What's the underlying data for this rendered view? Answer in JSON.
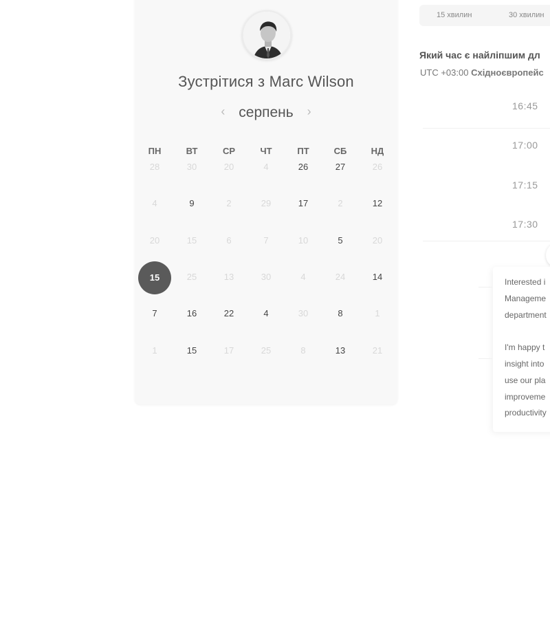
{
  "host": {
    "title": "Зустрітися з Marc Wilson"
  },
  "calendar": {
    "month": "серпень",
    "prev_icon": "chevron-left-icon",
    "next_icon": "chevron-right-icon",
    "weekdays": [
      "ПН",
      "ВТ",
      "СР",
      "ЧТ",
      "ПТ",
      "СБ",
      "НД"
    ],
    "weeks": [
      [
        "28",
        "30",
        "20",
        "4",
        "26",
        "27",
        "26"
      ],
      [
        "4",
        "9",
        "2",
        "29",
        "17",
        "2",
        "12"
      ],
      [
        "20",
        "15",
        "6",
        "7",
        "10",
        "5",
        "20"
      ],
      [
        "15",
        "25",
        "13",
        "30",
        "4",
        "24",
        "14"
      ],
      [
        "7",
        "16",
        "22",
        "4",
        "30",
        "8",
        "1"
      ],
      [
        "1",
        "15",
        "17",
        "25",
        "8",
        "13",
        "21"
      ]
    ],
    "available": [
      [
        false,
        false,
        false,
        false,
        true,
        true,
        false
      ],
      [
        false,
        true,
        false,
        false,
        true,
        false,
        true
      ],
      [
        false,
        false,
        false,
        false,
        false,
        true,
        false
      ],
      [
        true,
        false,
        false,
        false,
        false,
        false,
        true
      ],
      [
        true,
        true,
        true,
        true,
        false,
        true,
        false
      ],
      [
        false,
        true,
        false,
        false,
        false,
        true,
        false
      ]
    ],
    "selected": {
      "week": 3,
      "day": 0
    }
  },
  "durations": [
    "15 хвилин",
    "30 хвилин"
  ],
  "question": "Який час є найліпшим дл",
  "timezone": {
    "offset": "UTC +03:00",
    "name": "Східноєвропейс"
  },
  "slots": [
    "16:45",
    "17:00",
    "17:15",
    "17:30"
  ],
  "note": {
    "lines": [
      "Interested i",
      "Manageme",
      "department",
      "",
      "I'm happy t",
      "insight into",
      "use our pla",
      "improveme",
      "productivity"
    ]
  }
}
